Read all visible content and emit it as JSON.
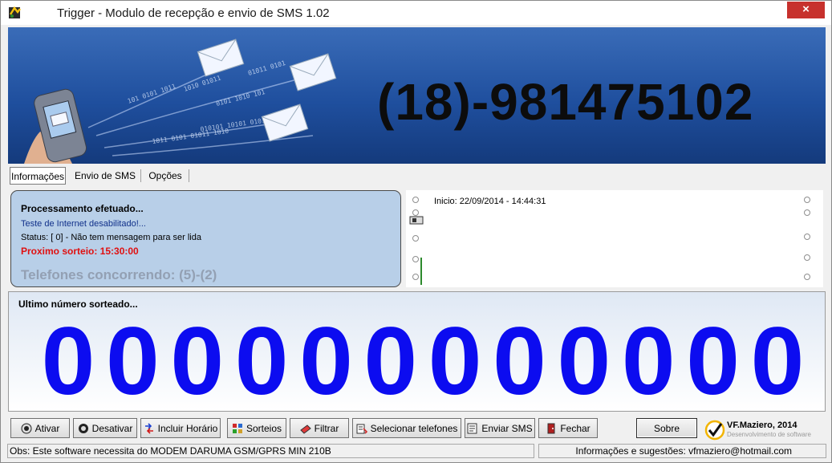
{
  "window": {
    "title": "Trigger - Modulo de recepção e envio de SMS 1.02",
    "close_glyph": "×"
  },
  "banner": {
    "phone_number": "(18)-981475102"
  },
  "tabs": [
    {
      "label": "Informações",
      "active": true
    },
    {
      "label": "Envio de SMS",
      "active": false
    },
    {
      "label": "Opções",
      "active": false
    }
  ],
  "info": {
    "title": "Processamento efetuado...",
    "internet_test": "Teste de Internet desabilitado!...",
    "status": "Status: [ 0] - Não tem mensagem para ser lida",
    "next_draw": "Proximo sorteio:  15:30:00",
    "participants": "Telefones concorrendo: (5)-(2)"
  },
  "log": {
    "start": "Inicio: 22/09/2014 - 14:44:31"
  },
  "draw": {
    "label": "Ultimo número sorteado...",
    "digits": [
      "0",
      "0",
      "0",
      "0",
      "0",
      "0",
      "0",
      "0",
      "0",
      "0",
      "0",
      "0"
    ]
  },
  "toolbar": {
    "ativar": "Ativar",
    "desativar": "Desativar",
    "incluir_horario": "Incluir Horário",
    "sorteios": "Sorteios",
    "filtrar": "Filtrar",
    "selecionar_telefones": "Selecionar telefones",
    "enviar_sms": "Enviar SMS",
    "fechar": "Fechar",
    "sobre": "Sobre"
  },
  "brand": {
    "name": "VF.Maziero, 2014",
    "subtitle": "Desenvolvimento de software"
  },
  "statusbar": {
    "left": "Obs: Este software necessita do  MODEM DARUMA GSM/GPRS MIN 210B",
    "right": "Informações e sugestões:  vfmaziero@hotmail.com"
  },
  "colors": {
    "banner": "#1f4f9e",
    "digits": "#0c0cf0",
    "next_draw": "#e01010",
    "info_bg": "#b8cfe8",
    "close": "#c7312d"
  }
}
